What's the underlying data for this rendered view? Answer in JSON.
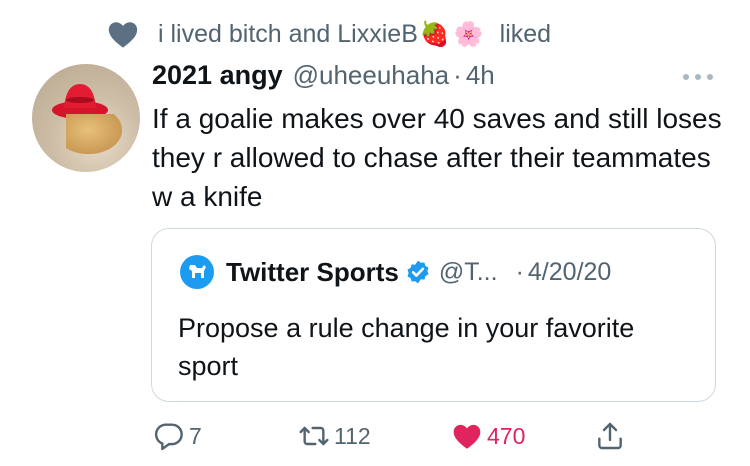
{
  "social_context": {
    "text": "i lived bitch and LixxieB",
    "emoji_1": "🍓",
    "emoji_2": "🌸",
    "suffix": "liked"
  },
  "tweet": {
    "display_name": "2021 angy",
    "handle": "@uheeuhaha",
    "separator": "·",
    "timestamp": "4h",
    "text": "If a goalie makes over 40 saves and still loses they r allowed to chase after their teammates w a knife"
  },
  "quote": {
    "display_name": "Twitter Sports",
    "handle": "@T...",
    "separator": "·",
    "date": "4/20/20",
    "text": "Propose a rule change in your favorite sport"
  },
  "actions": {
    "reply_count": "7",
    "retweet_count": "112",
    "like_count": "470"
  },
  "colors": {
    "like": "#e0245e",
    "brand_blue": "#1d9bf0",
    "secondary_text": "#536471",
    "social_heart": "#5b7083"
  },
  "icons": {
    "social_context": "heart-icon",
    "more": "more-horizontal-icon",
    "verified": "verified-badge-icon",
    "reply": "reply-icon",
    "retweet": "retweet-icon",
    "like": "heart-filled-icon",
    "share": "share-icon"
  }
}
